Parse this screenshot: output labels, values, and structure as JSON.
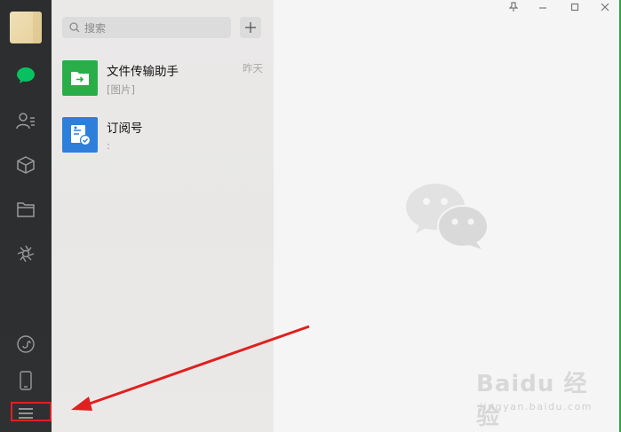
{
  "sidebar": {
    "icons": [
      "avatar",
      "chat-icon",
      "contacts-icon",
      "favorites-cube-icon",
      "files-folder-icon",
      "moments-icon",
      "mini-program-icon",
      "phone-icon",
      "menu-icon"
    ]
  },
  "search": {
    "placeholder": "搜索"
  },
  "chats": [
    {
      "name": "文件传输助手",
      "preview": "[图片]",
      "time": "昨天",
      "color": "#2aae4a"
    },
    {
      "name": "订阅号",
      "preview": ":",
      "time": "",
      "color": "#2d7fd9"
    }
  ],
  "watermark": {
    "brand": "Bai",
    "brand_suffix": "经验",
    "domain": "jingyan.baidu.com"
  },
  "colors": {
    "accent": "#07c160",
    "annotation": "#e02020"
  }
}
